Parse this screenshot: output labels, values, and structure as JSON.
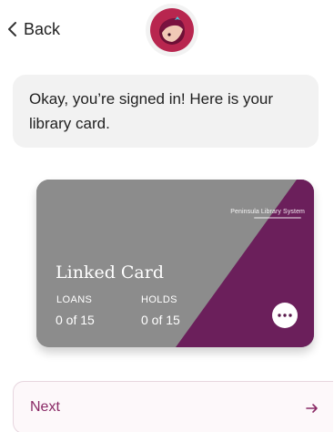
{
  "header": {
    "back_label": "Back",
    "back_icon": "chevron-left-icon",
    "avatar_icon": "libby-avatar-icon"
  },
  "message": {
    "text": "Okay, you’re signed in! Here is your library card."
  },
  "card": {
    "issuer": "Peninsula Library System",
    "name": "Linked Card",
    "loans_label": "LOANS",
    "loans_value": "0 of 15",
    "holds_label": "HOLDS",
    "holds_value": "0 of 15",
    "more_icon": "more-icon",
    "colors": {
      "base": "#8c8c8c",
      "accent": "#6b1f5b"
    }
  },
  "footer": {
    "next_label": "Next",
    "next_icon": "arrow-right-icon"
  },
  "colors": {
    "brand": "#8a2a66",
    "bubble_bg": "#f2f2f2"
  }
}
